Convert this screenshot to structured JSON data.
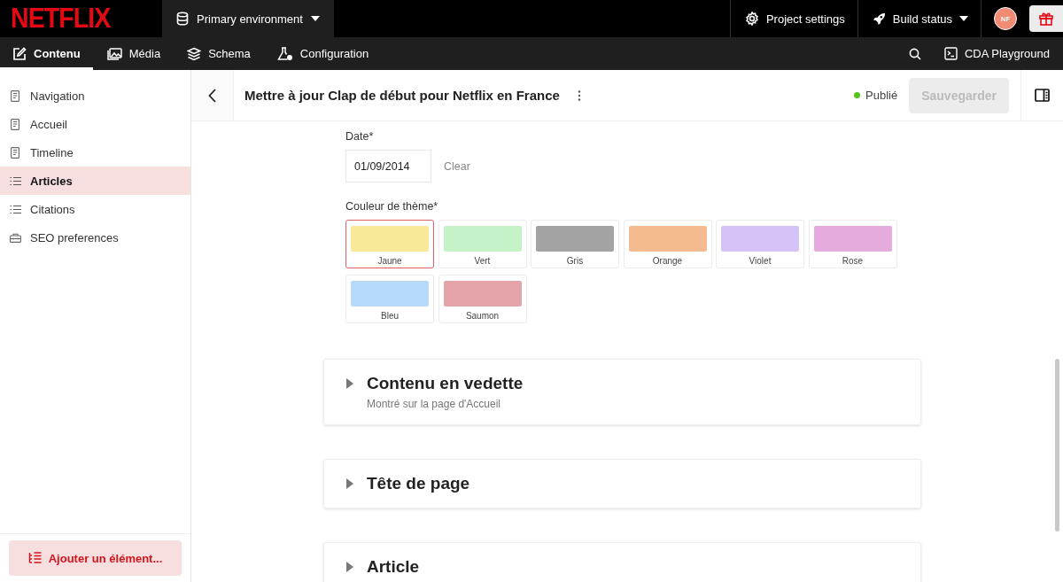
{
  "brand": {
    "logo": "NETFLIX"
  },
  "topbar": {
    "environment": "Primary environment",
    "project_settings": "Project settings",
    "build_status": "Build status",
    "avatar": "NF"
  },
  "nav": {
    "tabs": [
      {
        "label": "Contenu",
        "kind": "edit",
        "selected": true
      },
      {
        "label": "Média",
        "kind": "media",
        "selected": false
      },
      {
        "label": "Schema",
        "kind": "layers",
        "selected": false
      },
      {
        "label": "Configuration",
        "kind": "flask",
        "selected": false
      }
    ],
    "playground": "CDA Playground"
  },
  "sidebar": {
    "items": [
      {
        "label": "Navigation",
        "kind": "single",
        "selected": false
      },
      {
        "label": "Accueil",
        "kind": "single",
        "selected": false
      },
      {
        "label": "Timeline",
        "kind": "single",
        "selected": false
      },
      {
        "label": "Articles",
        "kind": "list",
        "selected": true
      },
      {
        "label": "Citations",
        "kind": "list",
        "selected": false
      },
      {
        "label": "SEO preferences",
        "kind": "block",
        "selected": false
      }
    ],
    "add_button": "Ajouter un élément..."
  },
  "editor": {
    "title": "Mettre à jour Clap de début pour Netflix en France",
    "status": "Publié",
    "save_button": {
      "label": "Sauvegarder",
      "disabled": true
    }
  },
  "form": {
    "date": {
      "label": "Date*",
      "value": "01/09/2014",
      "clear": "Clear"
    },
    "theme_color": {
      "label": "Couleur de thème*",
      "options": [
        {
          "label": "Jaune",
          "color": "#f8e998",
          "selected": true
        },
        {
          "label": "Vert",
          "color": "#c5f2c7",
          "selected": false
        },
        {
          "label": "Gris",
          "color": "#a3a3a3",
          "selected": false
        },
        {
          "label": "Orange",
          "color": "#f4bb91",
          "selected": false
        },
        {
          "label": "Violet",
          "color": "#d3c3f6",
          "selected": false
        },
        {
          "label": "Rose",
          "color": "#e6abdd",
          "selected": false
        },
        {
          "label": "Bleu",
          "color": "#b6d9f9",
          "selected": false
        },
        {
          "label": "Saumon",
          "color": "#e5a3aa",
          "selected": false
        }
      ]
    }
  },
  "sections": [
    {
      "title": "Contenu en vedette",
      "subtitle": "Montré sur la page d'Accueil",
      "expanded": false
    },
    {
      "title": "Tête de page",
      "expanded": false
    },
    {
      "title": "Article",
      "expanded": false
    }
  ]
}
